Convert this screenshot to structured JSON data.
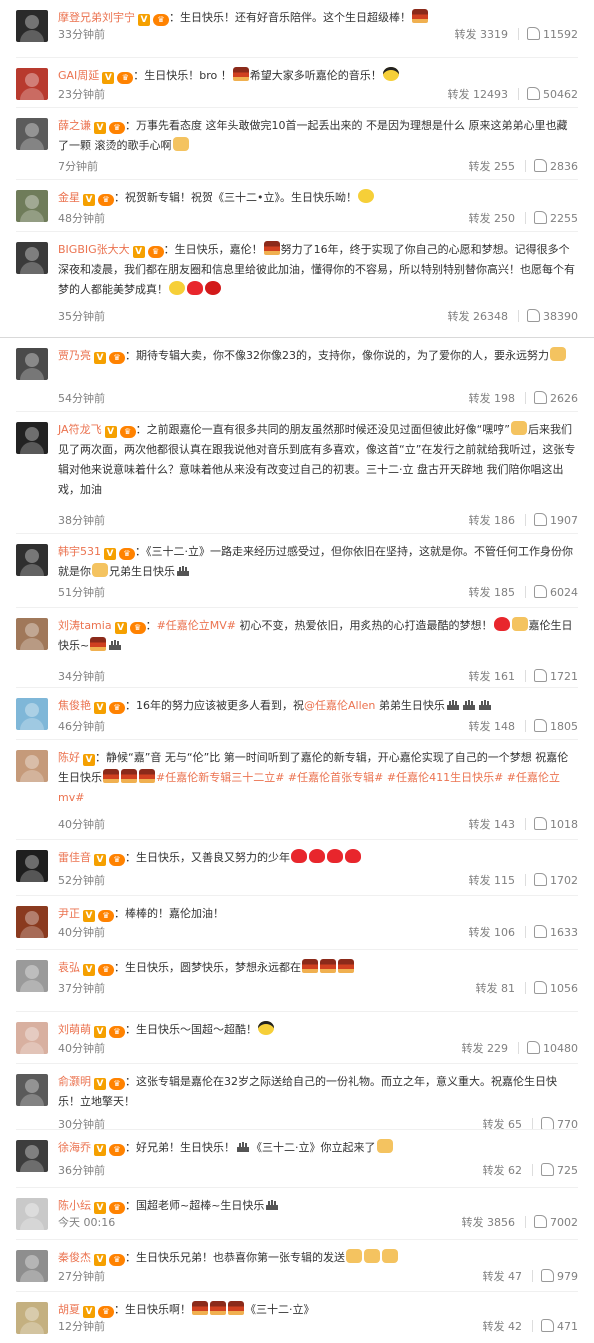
{
  "labels": {
    "repost": "转发"
  },
  "colors": {
    "name": "#eb7350",
    "text": "#333333",
    "meta": "#808080",
    "verified_badge": "#f5a000",
    "vip_badge": "#ff8200"
  },
  "comments": [
    {
      "name": "摩登兄弟刘宇宁",
      "verified": "V",
      "vip": "♛",
      "sep": "：",
      "segments": [
        {
          "t": "生日快乐！还有好音乐陪伴。这个生日超级棒！"
        },
        {
          "e": "cake-icon"
        }
      ],
      "time": "33分钟前",
      "reposts": "3319",
      "likes": "11592",
      "avatar_color": "#2a2a2a"
    },
    {
      "name": "GAI周延",
      "verified": "V",
      "vip": "♛",
      "sep": "：",
      "segments": [
        {
          "t": "生日快乐！bro ！"
        },
        {
          "e": "cake-icon"
        },
        {
          "t": "希望大家多听嘉伦的音乐！"
        },
        {
          "e": "cool-face-icon"
        }
      ],
      "time": "23分钟前",
      "reposts": "12493",
      "likes": "50462",
      "avatar_color": "#b83a2e"
    },
    {
      "name": "薛之谦",
      "verified": "V",
      "vip": "♛",
      "sep": "：",
      "segments": [
        {
          "t": "万事先看态度 这年头敢做完10首一起丢出来的 不是因为理想是什么 原来这弟弟心里也藏了一颗 滚烫的歌手心啊"
        },
        {
          "e": "thumb-icon"
        }
      ],
      "time": "7分钟前",
      "reposts": "255",
      "likes": "2836",
      "avatar_color": "#5b5b5b"
    },
    {
      "name": "金星",
      "verified": "V",
      "vip": "♛",
      "sep": "：",
      "segments": [
        {
          "t": "祝贺新专辑！祝贺《三十二•立》。生日快乐呦！"
        },
        {
          "e": "smile-icon"
        }
      ],
      "time": "48分钟前",
      "reposts": "250",
      "likes": "2255",
      "avatar_color": "#6f7c5a"
    },
    {
      "name": "BIGBIG张大大",
      "verified": "V",
      "vip": "♛",
      "sep": "：",
      "segments": [
        {
          "t": "生日快乐，嘉伦！"
        },
        {
          "e": "cake-icon"
        },
        {
          "t": "努力了16年，终于实现了你自己的心愿和梦想。记得很多个深夜和凌晨，我们都在朋友圈和信息里给彼此加油，懂得你的不容易，所以特别特别替你高兴！也愿每个有梦的人都能美梦成真！"
        },
        {
          "e": "hug-icon"
        },
        {
          "e": "heart-icon"
        },
        {
          "e": "rose-icon"
        }
      ],
      "time": "35分钟前",
      "reposts": "26348",
      "likes": "38390",
      "avatar_color": "#3a3a3a"
    },
    {
      "name": "贾乃亮",
      "verified": "V",
      "vip": "♛",
      "sep": "：",
      "segments": [
        {
          "t": "期待专辑大卖，你不像32你像23的，支持你，像你说的，为了爱你的人，要永远努力"
        },
        {
          "e": "thumb-icon"
        }
      ],
      "time": "54分钟前",
      "reposts": "198",
      "likes": "2626",
      "avatar_color": "#4a4a4a"
    },
    {
      "name": "JA符龙飞",
      "verified": "V",
      "vip": "♛",
      "sep": "：",
      "segments": [
        {
          "t": "之前跟嘉伦一直有很多共同的朋友虽然那时候还没见过面但彼此好像“嘿哼”"
        },
        {
          "e": "handshake-icon"
        },
        {
          "t": "后来我们见了两次面，两次他都很认真在跟我说他对音乐到底有多喜欢，像这首“立”在发行之前就给我听过，这张专辑对他来说意味着什么？意味着他从来没有改变过自己的初衷。三十二·立 盘古开天辟地 我们陪你唱这出戏，加油"
        }
      ],
      "time": "38分钟前",
      "reposts": "186",
      "likes": "1907",
      "avatar_color": "#222222"
    },
    {
      "name": "韩宇531",
      "verified": "V",
      "vip": "♛",
      "sep": "：",
      "segments": [
        {
          "t": "《三十二·立》一路走来经历过感受过，但你依旧在坚持，这就是你。不管任何工作身份你就是你"
        },
        {
          "e": "thumb-icon"
        },
        {
          "t": "兄弟生日快乐"
        },
        {
          "e": "candle-icon"
        }
      ],
      "time": "51分钟前",
      "reposts": "185",
      "likes": "6024",
      "avatar_color": "#2f2f2f"
    },
    {
      "name": "刘涛tamia",
      "verified": "V",
      "vip": "♛",
      "sep": "：",
      "segments": [
        {
          "tag": "#任嘉伦立MV#"
        },
        {
          "t": " 初心不变，热爱依旧，用炙热的心打造最酷的梦想！"
        },
        {
          "e": "heart-icon"
        },
        {
          "e": "thumb-icon"
        },
        {
          "t": "嘉伦生日快乐~"
        },
        {
          "e": "cake-icon"
        },
        {
          "e": "candle-icon"
        }
      ],
      "time": "34分钟前",
      "reposts": "161",
      "likes": "1721",
      "avatar_color": "#a0785a"
    },
    {
      "name": "焦俊艳",
      "verified": "V",
      "vip": "♛",
      "sep": "：",
      "segments": [
        {
          "t": "16年的努力应该被更多人看到，祝"
        },
        {
          "tag": "@任嘉伦Allen"
        },
        {
          "t": " 弟弟生日快乐"
        },
        {
          "e": "candle-icon"
        },
        {
          "e": "candle-icon"
        },
        {
          "e": "candle-icon"
        }
      ],
      "time": "46分钟前",
      "reposts": "148",
      "likes": "1805",
      "avatar_color": "#7fb7d8"
    },
    {
      "name": "陈好",
      "verified": "V",
      "vip": "",
      "sep": "：",
      "segments": [
        {
          "t": "静候“嘉”音 无与“伦”比  第一时间听到了嘉伦的新专辑，开心嘉伦实现了自己的一个梦想  祝嘉伦生日快乐"
        },
        {
          "e": "cake-icon"
        },
        {
          "e": "cake-icon"
        },
        {
          "e": "cake-icon"
        },
        {
          "tag": "#任嘉伦新专辑三十二立# #任嘉伦首张专辑# #任嘉伦411生日快乐# #任嘉伦立mv#"
        }
      ],
      "time": "40分钟前",
      "reposts": "143",
      "likes": "1018",
      "avatar_color": "#c59a7a"
    },
    {
      "name": "雷佳音",
      "verified": "V",
      "vip": "♛",
      "sep": "：",
      "segments": [
        {
          "t": "生日快乐，又善良又努力的少年"
        },
        {
          "e": "heart-icon"
        },
        {
          "e": "heart-icon"
        },
        {
          "e": "heart-icon"
        },
        {
          "e": "heart-icon"
        }
      ],
      "time": "52分钟前",
      "reposts": "115",
      "likes": "1702",
      "avatar_color": "#1e1e1e"
    },
    {
      "name": "尹正",
      "verified": "V",
      "vip": "♛",
      "sep": "：",
      "segments": [
        {
          "t": "棒棒的！嘉伦加油！"
        }
      ],
      "time": "40分钟前",
      "reposts": "106",
      "likes": "1633",
      "avatar_color": "#8a3a1f"
    },
    {
      "name": "袁弘",
      "verified": "V",
      "vip": "♛",
      "sep": "：",
      "segments": [
        {
          "t": "生日快乐，圆梦快乐，梦想永远都在"
        },
        {
          "e": "cake-icon"
        },
        {
          "e": "cake-icon"
        },
        {
          "e": "cake-icon"
        }
      ],
      "time": "37分钟前",
      "reposts": "81",
      "likes": "1056",
      "avatar_color": "#9a9a9a"
    },
    {
      "name": "刘萌萌",
      "verified": "V",
      "vip": "♛",
      "sep": "：",
      "segments": [
        {
          "t": "生日快乐～国超～超酷！"
        },
        {
          "e": "cool-face-icon"
        }
      ],
      "time": "40分钟前",
      "reposts": "229",
      "likes": "10480",
      "avatar_color": "#d8b0a0"
    },
    {
      "name": "俞灏明",
      "verified": "V",
      "vip": "♛",
      "sep": "：",
      "segments": [
        {
          "t": "这张专辑是嘉伦在32岁之际送给自己的一份礼物。而立之年，意义重大。祝嘉伦生日快乐！立地擎天！"
        }
      ],
      "time": "30分钟前",
      "reposts": "65",
      "likes": "770",
      "avatar_color": "#5a5a5a"
    },
    {
      "name": "徐海乔",
      "verified": "V",
      "vip": "♛",
      "sep": "：",
      "segments": [
        {
          "t": "好兄弟！生日快乐！"
        },
        {
          "e": "candle-icon"
        },
        {
          "t": "《三十二·立》你立起来了"
        },
        {
          "e": "thumb-icon"
        }
      ],
      "time": "36分钟前",
      "reposts": "62",
      "likes": "725",
      "avatar_color": "#3d3d3d"
    },
    {
      "name": "陈小纭",
      "verified": "V",
      "vip": "♛",
      "sep": "：",
      "segments": [
        {
          "t": "国超老师~超棒~生日快乐"
        },
        {
          "e": "candle-icon"
        }
      ],
      "time": "今天 00:16",
      "reposts": "3856",
      "likes": "7002",
      "avatar_color": "#c9c9c9"
    },
    {
      "name": "秦俊杰",
      "verified": "V",
      "vip": "♛",
      "sep": "：",
      "segments": [
        {
          "t": "生日快乐兄弟！也恭喜你第一张专辑的发送"
        },
        {
          "e": "thumb-icon"
        },
        {
          "e": "thumb-icon"
        },
        {
          "e": "thumb-icon"
        }
      ],
      "time": "27分钟前",
      "reposts": "47",
      "likes": "979",
      "avatar_color": "#8e8e8e"
    },
    {
      "name": "胡夏",
      "verified": "V",
      "vip": "♛",
      "sep": "：",
      "segments": [
        {
          "t": "生日快乐啊！"
        },
        {
          "e": "cake-icon"
        },
        {
          "e": "cake-icon"
        },
        {
          "e": "cake-icon"
        },
        {
          "t": "《三十二·立》"
        }
      ],
      "time": "12分钟前",
      "reposts": "42",
      "likes": "471",
      "avatar_color": "#c4b080"
    }
  ]
}
